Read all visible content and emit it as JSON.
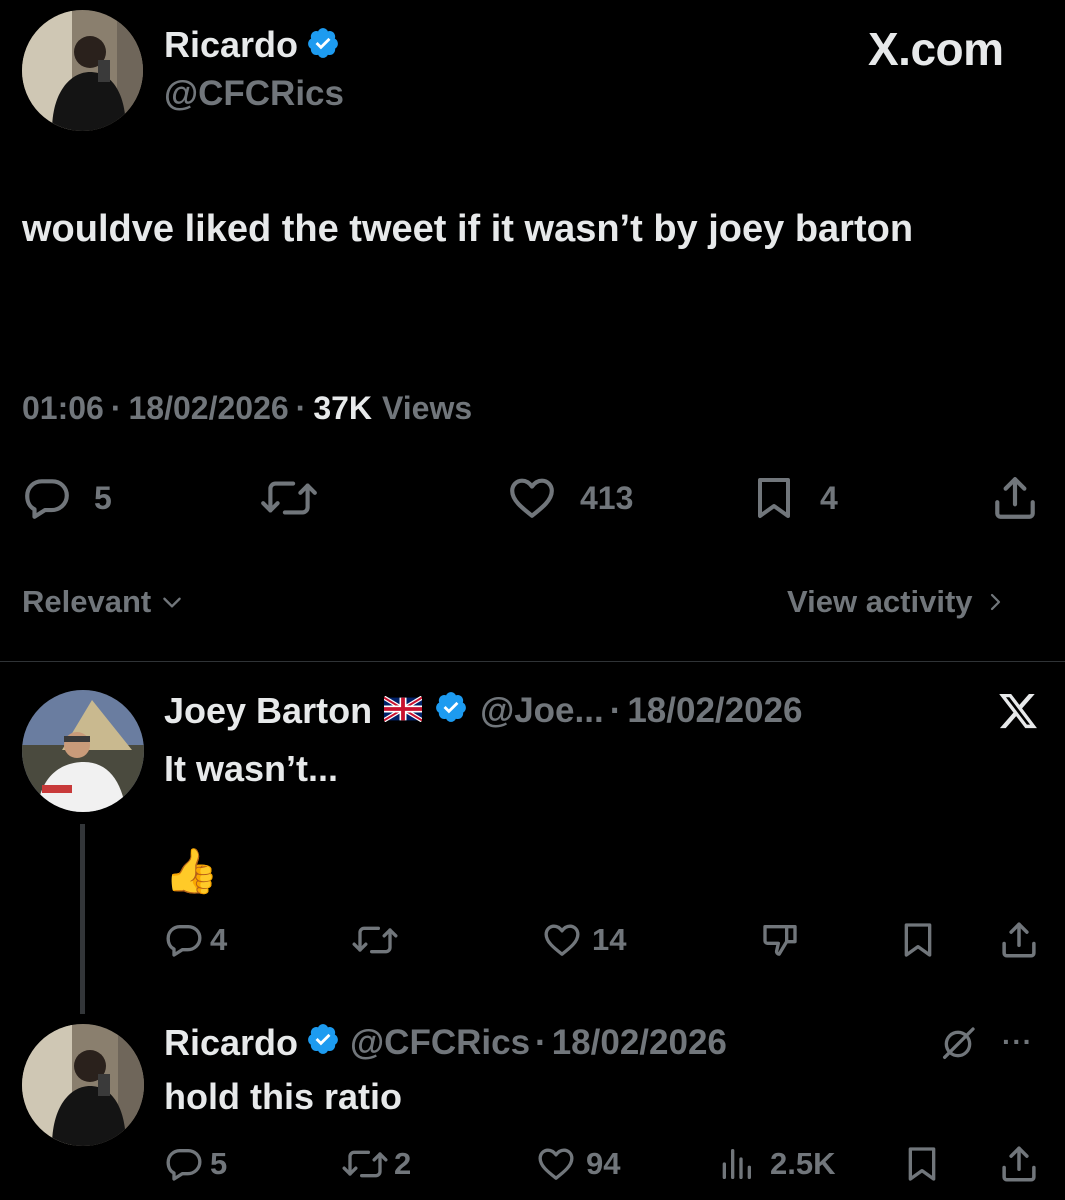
{
  "main_tweet": {
    "author_name": "Ricardo",
    "handle": "@CFCRics",
    "source": "X.com",
    "text": "wouldve liked the tweet if it wasn’t by joey barton",
    "time": "01:06",
    "date": "18/02/2026",
    "views_count": "37K",
    "views_label": "Views",
    "replies": "5",
    "likes": "413",
    "bookmarks": "4",
    "sep": "·"
  },
  "sort": {
    "label": "Relevant",
    "view_activity": "View activity"
  },
  "reply1": {
    "author_name": "Joey Barton",
    "handle": "@Joe...",
    "date": "18/02/2026",
    "text": "It wasn’t...",
    "emoji": "👍",
    "replies": "4",
    "likes": "14",
    "sep": "·"
  },
  "reply2": {
    "author_name": "Ricardo",
    "handle": "@CFCRics",
    "date": "18/02/2026",
    "text": "hold this ratio",
    "replies": "5",
    "retweets": "2",
    "likes": "94",
    "views": "2.5K",
    "more": "···",
    "sep": "·"
  },
  "colors": {
    "background": "#000000",
    "text": "#e7e9ea",
    "muted": "#71767b",
    "verified": "#1d9bf0"
  }
}
